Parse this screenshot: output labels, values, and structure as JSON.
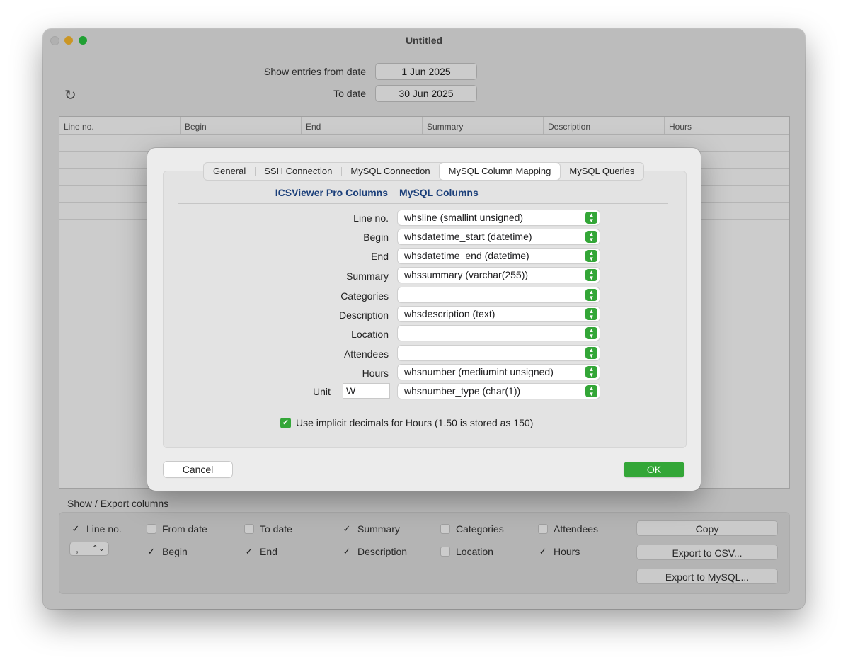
{
  "window": {
    "title": "Untitled"
  },
  "filters": {
    "from_label": "Show entries from date",
    "from_value": "1 Jun 2025",
    "to_label": "To date",
    "to_value": "30 Jun 2025"
  },
  "grid": {
    "columns": [
      "Line no.",
      "Begin",
      "End",
      "Summary",
      "Description",
      "Hours"
    ]
  },
  "export": {
    "title": "Show / Export columns",
    "checkboxes_row1": [
      {
        "label": "Line no.",
        "checked": true
      },
      {
        "label": "From date",
        "checked": false
      },
      {
        "label": "To date",
        "checked": false
      },
      {
        "label": "Summary",
        "checked": true
      },
      {
        "label": "Categories",
        "checked": false
      },
      {
        "label": "Attendees",
        "checked": false
      }
    ],
    "checkboxes_row2": [
      {
        "label": "Begin",
        "checked": true
      },
      {
        "label": "End",
        "checked": true
      },
      {
        "label": "Description",
        "checked": true
      },
      {
        "label": "Location",
        "checked": false
      },
      {
        "label": "Hours",
        "checked": true
      }
    ],
    "delimiter": ",",
    "copy_label": "Copy",
    "csv_label": "Export to CSV...",
    "mysql_label": "Export to MySQL..."
  },
  "sheet": {
    "tabs": [
      "General",
      "SSH Connection",
      "MySQL Connection",
      "MySQL Column Mapping",
      "MySQL Queries"
    ],
    "selected_tab": "MySQL Column Mapping",
    "col_left": "ICSViewer Pro Columns",
    "col_right": "MySQL Columns",
    "mappings": [
      {
        "label": "Line no.",
        "value": "whsline (smallint unsigned)"
      },
      {
        "label": "Begin",
        "value": "whsdatetime_start (datetime)"
      },
      {
        "label": "End",
        "value": "whsdatetime_end (datetime)"
      },
      {
        "label": "Summary",
        "value": "whssummary (varchar(255))"
      },
      {
        "label": "Categories",
        "value": ""
      },
      {
        "label": "Description",
        "value": "whsdescription (text)"
      },
      {
        "label": "Location",
        "value": ""
      },
      {
        "label": "Attendees",
        "value": ""
      },
      {
        "label": "Hours",
        "value": "whsnumber (mediumint unsigned)"
      }
    ],
    "unit_label": "Unit",
    "unit_value": "W",
    "unit_mapping": "whsnumber_type (char(1))",
    "implicit_label": "Use implicit decimals for Hours (1.50 is stored as 150)",
    "implicit_checked": true,
    "cancel_label": "Cancel",
    "ok_label": "OK"
  }
}
